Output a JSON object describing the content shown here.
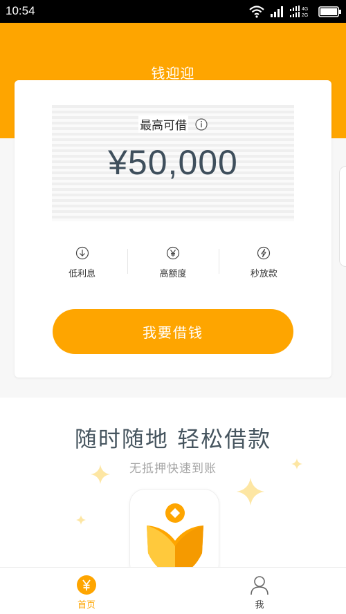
{
  "status_bar": {
    "time": "10:54",
    "icons": [
      "wifi-icon",
      "signal-icon",
      "signal-4g-2g-icon",
      "battery-icon"
    ],
    "network_labels": [
      "4G",
      "2G"
    ]
  },
  "header": {
    "title": "钱迎迎",
    "background_color": "#fea500"
  },
  "card": {
    "limit_label": "最高可借",
    "limit_amount": "¥50,000",
    "features": [
      {
        "icon": "arrow-down-circle-icon",
        "label": "低利息"
      },
      {
        "icon": "yen-circle-icon",
        "label": "高额度"
      },
      {
        "icon": "lightning-circle-icon",
        "label": "秒放款"
      }
    ],
    "cta_label": "我要借钱"
  },
  "promo": {
    "title": "随时随地 轻松借款",
    "subtitle": "无抵押快速到账",
    "app_icon": "app-logo-icon"
  },
  "tabbar": {
    "tabs": [
      {
        "icon": "yen-icon",
        "label": "首页",
        "active": true
      },
      {
        "icon": "user-icon",
        "label": "我",
        "active": false
      }
    ]
  },
  "colors": {
    "accent": "#fea500",
    "amount_text": "#3f4f5c"
  }
}
